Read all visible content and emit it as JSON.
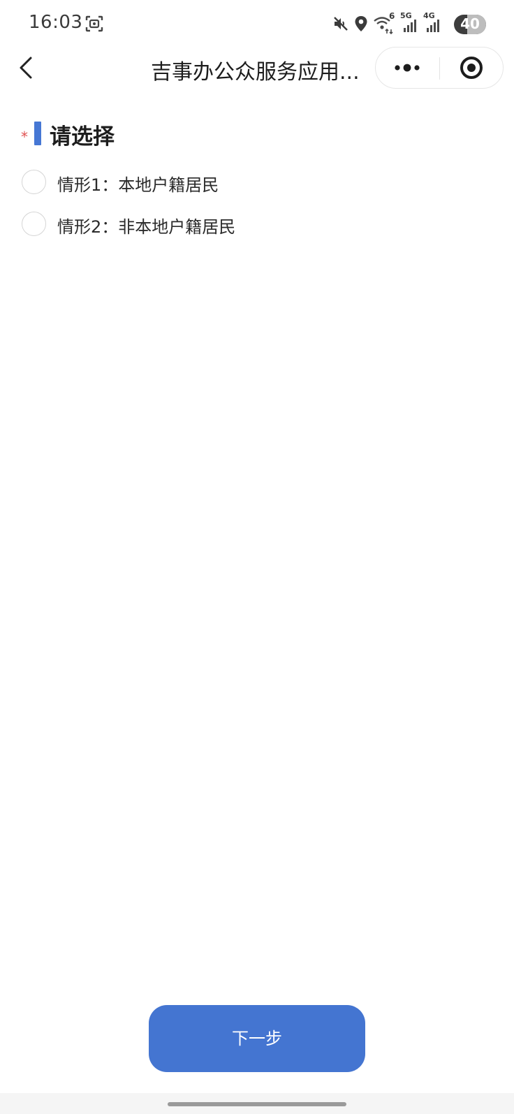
{
  "status_bar": {
    "time": "16:03",
    "network_labels": [
      "6",
      "5G",
      "4G"
    ],
    "battery": "40",
    "icons": [
      "screenshot-icon",
      "mute-icon",
      "location-icon",
      "wifi-icon",
      "signal-5g-icon",
      "signal-4g-icon",
      "battery-icon"
    ]
  },
  "nav": {
    "title": "吉事办公众服务应用...",
    "back_icon": "chevron-left-icon",
    "capsule_icons": [
      "more-dots-icon",
      "close-target-icon"
    ]
  },
  "form": {
    "required_mark": "*",
    "section_title": "请选择",
    "options": [
      {
        "label": "情形1：本地户籍居民",
        "selected": false
      },
      {
        "label": "情形2：非本地户籍居民",
        "selected": false
      }
    ]
  },
  "actions": {
    "next_label": "下一步"
  },
  "colors": {
    "accent": "#4677d4",
    "button": "#4475d1",
    "required": "#e05353"
  }
}
